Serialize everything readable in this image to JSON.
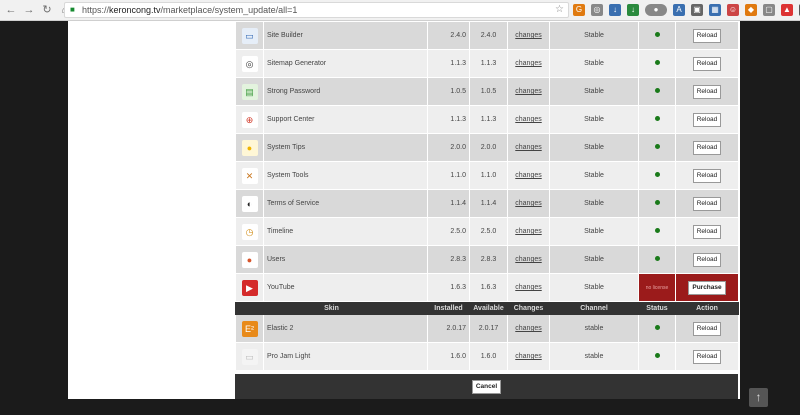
{
  "browser": {
    "url_scheme": "https://",
    "url_host": "keroncong.tv",
    "url_path": "/marketplace/system_update/all=1",
    "colors": {
      "ext_red": "#d33",
      "ext_green": "#2b8a3e",
      "ext_blue": "#3a6fb0",
      "ext_orange": "#e07a10",
      "ext_grey": "#888"
    }
  },
  "plugins": [
    {
      "name": "Site Builder",
      "installed": "2.4.0",
      "available": "2.4.0",
      "changes": "changes",
      "channel": "Stable",
      "action": "Reload",
      "icon": "monitor-icon",
      "glyph": "▭",
      "bg": "#e6eef8",
      "fg": "#2a63b0"
    },
    {
      "name": "Sitemap Generator",
      "installed": "1.1.3",
      "available": "1.1.3",
      "changes": "changes",
      "channel": "Stable",
      "action": "Reload",
      "icon": "compass-icon",
      "glyph": "◎",
      "bg": "#ffffff",
      "fg": "#333"
    },
    {
      "name": "Strong Password",
      "installed": "1.0.5",
      "available": "1.0.5",
      "changes": "changes",
      "channel": "Stable",
      "action": "Reload",
      "icon": "password-icon",
      "glyph": "▤",
      "bg": "#e3f3de",
      "fg": "#3b9a3b"
    },
    {
      "name": "Support Center",
      "installed": "1.1.3",
      "available": "1.1.3",
      "changes": "changes",
      "channel": "Stable",
      "action": "Reload",
      "icon": "lifebuoy-icon",
      "glyph": "⊕",
      "bg": "#ffffff",
      "fg": "#d23a2a"
    },
    {
      "name": "System Tips",
      "installed": "2.0.0",
      "available": "2.0.0",
      "changes": "changes",
      "channel": "Stable",
      "action": "Reload",
      "icon": "lightbulb-icon",
      "glyph": "●",
      "bg": "#fff7d6",
      "fg": "#f0b400"
    },
    {
      "name": "System Tools",
      "installed": "1.1.0",
      "available": "1.1.0",
      "changes": "changes",
      "channel": "Stable",
      "action": "Reload",
      "icon": "tools-icon",
      "glyph": "✕",
      "bg": "#ffffff",
      "fg": "#c9761d"
    },
    {
      "name": "Terms of Service",
      "installed": "1.1.4",
      "available": "1.1.4",
      "changes": "changes",
      "channel": "Stable",
      "action": "Reload",
      "icon": "toggle-icon",
      "glyph": "◐",
      "bg": "#ffffff",
      "fg": "#222"
    },
    {
      "name": "Timeline",
      "installed": "2.5.0",
      "available": "2.5.0",
      "changes": "changes",
      "channel": "Stable",
      "action": "Reload",
      "icon": "clock-icon",
      "glyph": "◷",
      "bg": "#ffffff",
      "fg": "#d08a10"
    },
    {
      "name": "Users",
      "installed": "2.8.3",
      "available": "2.8.3",
      "changes": "changes",
      "channel": "Stable",
      "action": "Reload",
      "icon": "user-icon",
      "glyph": "●",
      "bg": "#ffffff",
      "fg": "#d6542a"
    },
    {
      "name": "YouTube",
      "installed": "1.6.3",
      "available": "1.6.3",
      "changes": "changes",
      "channel": "Stable",
      "action": "Purchase",
      "status_text": "no license",
      "icon": "youtube-icon",
      "glyph": "▶",
      "bg": "#d42a2a",
      "fg": "#ffffff"
    }
  ],
  "skins_header": {
    "skin": "Skin",
    "installed": "Installed",
    "available": "Available",
    "changes": "Changes",
    "channel": "Channel",
    "status": "Status",
    "action": "Action"
  },
  "skins": [
    {
      "name": "Elastic 2",
      "installed": "2.0.17",
      "available": "2.0.17",
      "changes": "changes",
      "channel": "stable",
      "action": "Reload",
      "icon": "elastic-icon",
      "glyph": "E²",
      "bg": "#e88a1a",
      "fg": "#ffffff"
    },
    {
      "name": "Pro Jam Light",
      "installed": "1.6.0",
      "available": "1.6.0",
      "changes": "changes",
      "channel": "stable",
      "action": "Reload",
      "icon": "skin-thumbnail-icon",
      "glyph": "▭",
      "bg": "#f4f4f4",
      "fg": "#bbb"
    }
  ],
  "footer": {
    "cancel_label": "Cancel"
  }
}
